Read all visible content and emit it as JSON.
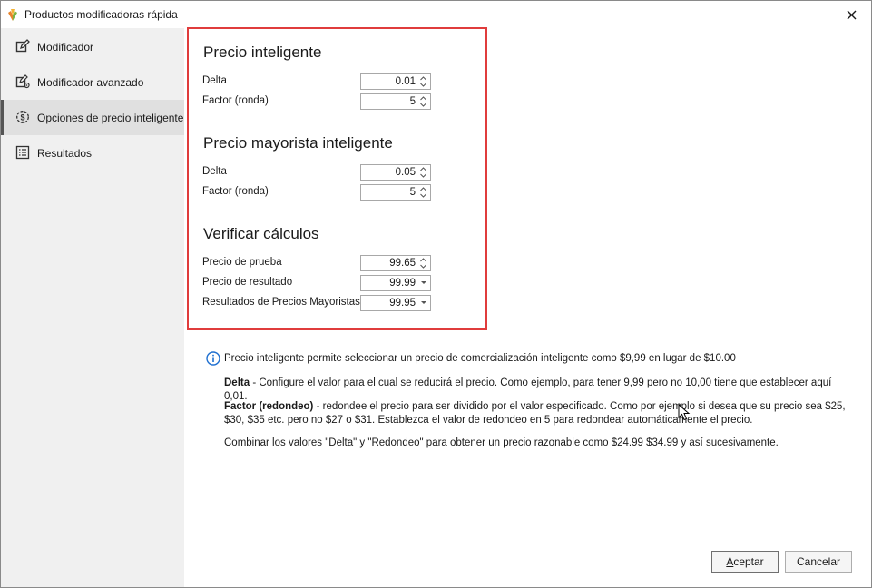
{
  "window": {
    "title": "Productos modificadoras rápida"
  },
  "sidebar": {
    "items": [
      {
        "label": "Modificador",
        "icon": "edit-icon",
        "active": false
      },
      {
        "label": "Modificador avanzado",
        "icon": "advanced-edit-icon",
        "active": false
      },
      {
        "label": "Opciones de precio inteligente",
        "icon": "price-settings-icon",
        "active": true
      },
      {
        "label": "Resultados",
        "icon": "list-icon",
        "active": false
      }
    ]
  },
  "smart_price": {
    "title": "Precio inteligente",
    "delta_label": "Delta",
    "delta_value": "0.01",
    "factor_label": "Factor (ronda)",
    "factor_value": "5"
  },
  "wholesale_price": {
    "title": "Precio mayorista inteligente",
    "delta_label": "Delta",
    "delta_value": "0.05",
    "factor_label": "Factor (ronda)",
    "factor_value": "5"
  },
  "verify": {
    "title": "Verificar cálculos",
    "test_price_label": "Precio de prueba",
    "test_price_value": "99.65",
    "result_price_label": "Precio de resultado",
    "result_price_value": "99.99",
    "wholesale_result_label": "Resultados de Precios Mayoristas",
    "wholesale_result_value": "99.95"
  },
  "info": {
    "intro": "Precio inteligente permite seleccionar un precio de comercialización inteligente como $9,99 en lugar de $10.00",
    "delta_term": "Delta",
    "delta_desc": " - Configure el valor para el cual se reducirá el precio. Como ejemplo, para tener 9,99 pero no 10,00 tiene que establecer aquí 0,01.",
    "factor_term": "Factor (redondeo)",
    "factor_desc": " - redondee el precio para ser dividido por el valor especificado. Como por ejemplo si desea que su precio sea $25, $30, $35 etc. pero no $27 o $31. Establezca el valor de redondeo en 5 para redondear automáticamente el precio.",
    "combine": "Combinar los valores \"Delta\" y \"Redondeo\" para obtener un precio razonable como $24.99 $34.99 y así sucesivamente."
  },
  "buttons": {
    "accept_underlined": "A",
    "accept_rest": "ceptar",
    "cancel": "Cancelar"
  },
  "colors": {
    "highlight_border": "#e03c3c",
    "info_icon": "#1e6fd0",
    "sidebar_bg": "#f0f0f0"
  }
}
